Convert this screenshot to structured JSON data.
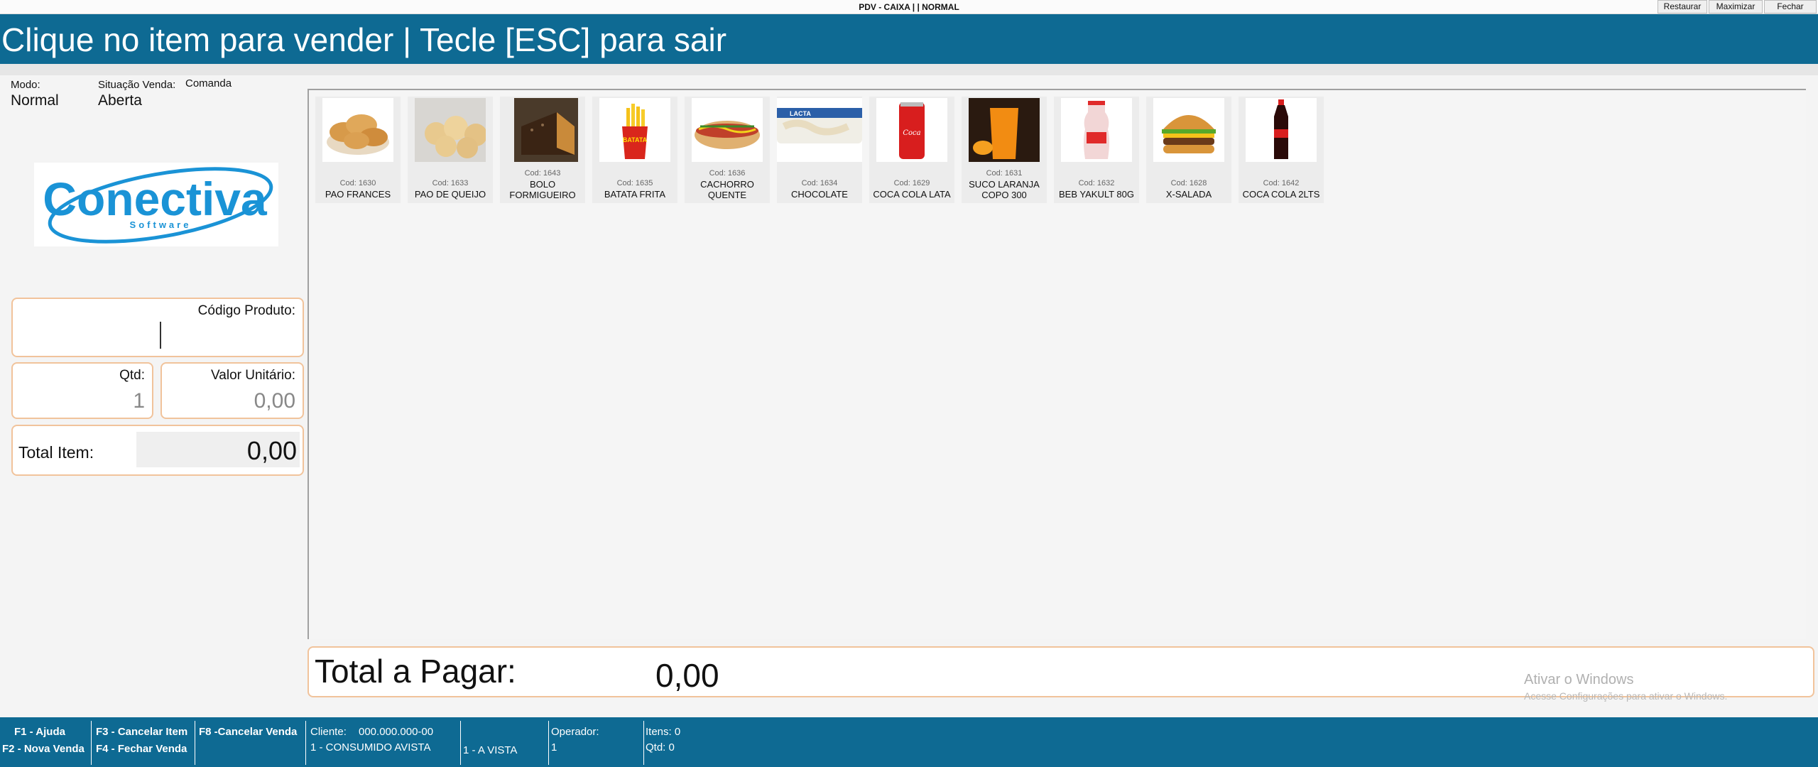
{
  "window": {
    "title": "PDV - CAIXA | | NORMAL",
    "buttons": {
      "restore": "Restaurar",
      "maximize": "Maximizar",
      "close": "Fechar"
    }
  },
  "header": {
    "text": "Clique no item para vender | Tecle [ESC] para sair"
  },
  "status": {
    "modo_label": "Modo:",
    "modo_value": "Normal",
    "situacao_label": "Situação Venda:",
    "situacao_value": "Aberta",
    "comanda_label": "Comanda"
  },
  "logo": {
    "name": "Conectiva",
    "sub": "Software"
  },
  "fields": {
    "codigo_label": "Código Produto:",
    "codigo_value": "",
    "qtd_label": "Qtd:",
    "qtd_value": "1",
    "valor_label": "Valor Unitário:",
    "valor_value": "0,00",
    "total_item_label": "Total Item:",
    "total_item_value": "0,00"
  },
  "products": [
    {
      "code": "Cod: 1630",
      "name": "PAO FRANCES",
      "icon": "bread-image"
    },
    {
      "code": "Cod: 1633",
      "name": "PAO DE QUEIJO",
      "icon": "cheese-bread-image"
    },
    {
      "code": "Cod: 1643",
      "name": "BOLO FORMIGUEIRO",
      "icon": "cake-image"
    },
    {
      "code": "Cod: 1635",
      "name": "BATATA FRITA",
      "icon": "fries-image"
    },
    {
      "code": "Cod: 1636",
      "name": "CACHORRO QUENTE",
      "icon": "hotdog-image"
    },
    {
      "code": "Cod: 1634",
      "name": "CHOCOLATE",
      "icon": "chocolate-image"
    },
    {
      "code": "Cod: 1629",
      "name": "COCA COLA LATA",
      "icon": "soda-can-image"
    },
    {
      "code": "Cod: 1631",
      "name": "SUCO LARANJA COPO 300",
      "icon": "orange-juice-image"
    },
    {
      "code": "Cod: 1632",
      "name": "BEB YAKULT 80G",
      "icon": "yakult-image"
    },
    {
      "code": "Cod: 1628",
      "name": "X-SALADA",
      "icon": "burger-image"
    },
    {
      "code": "Cod: 1642",
      "name": "COCA COLA 2LTS",
      "icon": "soda-bottle-image"
    }
  ],
  "total_pagar": {
    "label": "Total a Pagar:",
    "value": "0,00"
  },
  "watermark": {
    "title": "Ativar o Windows",
    "sub": "Acesse Configurações para ativar o Windows."
  },
  "footer": {
    "f1": "F1 - Ajuda",
    "f2": "F2 - Nova Venda",
    "f3": "F3 - Cancelar Item",
    "f4": "F4 - Fechar Venda",
    "f8": "F8 -Cancelar Venda",
    "cliente_label": "Cliente:",
    "cliente_doc": "000.000.000-00",
    "cliente_name": "1 - CONSUMIDO AVISTA",
    "pagamento": "1 - A VISTA",
    "operador_label": "Operador:",
    "operador_value": "1",
    "itens": "Itens: 0",
    "qtd": "Qtd: 0"
  },
  "colors": {
    "brand_blue": "#0e6a93",
    "field_border": "#f1c39b",
    "logo_blue": "#1a93d6",
    "logo_orange": "#f28c1c"
  }
}
